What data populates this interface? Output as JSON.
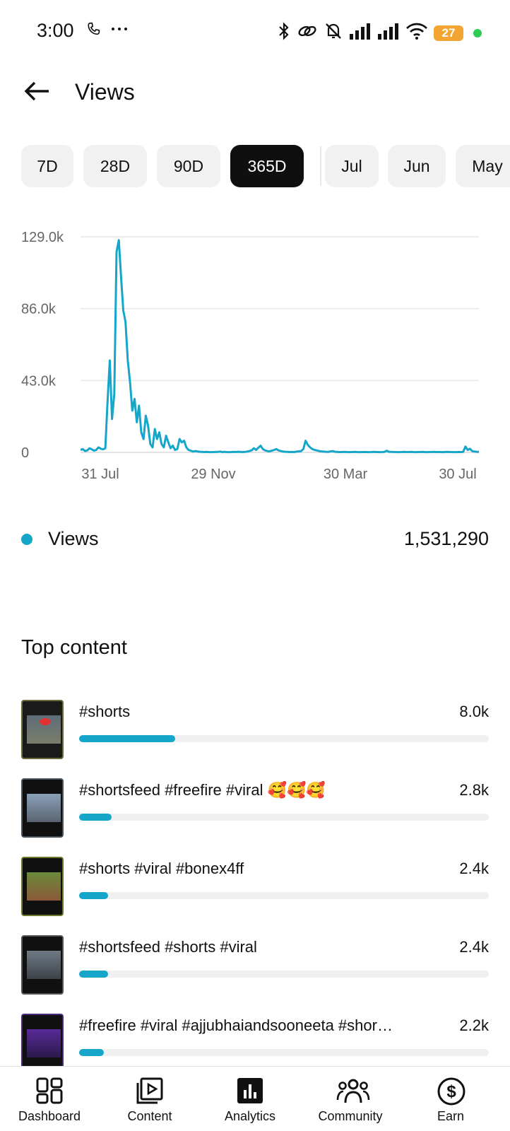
{
  "status_bar": {
    "time": "3:00",
    "battery": "27"
  },
  "header": {
    "title": "Views"
  },
  "period_chips": [
    {
      "label": "7D",
      "active": false
    },
    {
      "label": "28D",
      "active": false
    },
    {
      "label": "90D",
      "active": false
    },
    {
      "label": "365D",
      "active": true
    },
    {
      "label": "Jul",
      "active": false
    },
    {
      "label": "Jun",
      "active": false
    },
    {
      "label": "May",
      "active": false
    }
  ],
  "chart_data": {
    "type": "line",
    "y_ticks": [
      "129.0k",
      "86.0k",
      "43.0k",
      "0"
    ],
    "x_ticks": [
      "31 Jul",
      "29 Nov",
      "30 Mar",
      "30 Jul"
    ],
    "ylim": [
      0,
      129000
    ],
    "grid": true,
    "series": [
      {
        "name": "Views",
        "color": "#16a6c9",
        "values": [
          1500,
          2000,
          800,
          1200,
          2500,
          1800,
          1000,
          1500,
          3000,
          2200,
          1800,
          2500,
          30000,
          55000,
          20000,
          35000,
          120000,
          127000,
          105000,
          85000,
          78000,
          55000,
          42000,
          25000,
          32000,
          18000,
          28000,
          12000,
          8000,
          22000,
          16000,
          5000,
          3000,
          14000,
          8000,
          12000,
          5000,
          3000,
          10000,
          6000,
          2500,
          4000,
          1500,
          2000,
          8000,
          6000,
          7000,
          3000,
          1500,
          1000,
          500,
          800,
          600,
          400,
          300,
          200,
          300,
          200,
          150,
          200,
          250,
          300,
          500,
          200,
          300,
          200,
          150,
          200,
          300,
          250,
          400,
          300,
          200,
          300,
          500,
          800,
          1200,
          2500,
          1500,
          2800,
          4000,
          2000,
          1200,
          800,
          600,
          1000,
          1500,
          2000,
          1200,
          800,
          500,
          400,
          300,
          200,
          300,
          200,
          500,
          600,
          800,
          2000,
          7000,
          4500,
          3000,
          2000,
          1500,
          1200,
          800,
          600,
          500,
          400,
          300,
          600,
          800,
          400,
          300,
          200,
          200,
          300,
          250,
          150,
          200,
          250,
          300,
          200,
          150,
          200,
          250,
          200,
          150,
          200,
          300,
          250,
          200,
          150,
          200,
          300,
          1000,
          400,
          300,
          250,
          200,
          150,
          200,
          250,
          300,
          200,
          250,
          300,
          200,
          150,
          200,
          250,
          300,
          200,
          150,
          200,
          250,
          300,
          200,
          250,
          200,
          150,
          250,
          300,
          250,
          200,
          150,
          200,
          250,
          200,
          300,
          3500,
          1500,
          2200,
          800,
          500,
          400,
          300
        ]
      }
    ]
  },
  "legend": {
    "label": "Views",
    "total": "1,531,290"
  },
  "top_content": {
    "title": "Top content",
    "items": [
      {
        "title": "#shorts",
        "value": "8.0k",
        "share": 0.235
      },
      {
        "title": "#shortsfeed #freefire #viral 🥰🥰🥰",
        "value": "2.8k",
        "share": 0.08
      },
      {
        "title": "#shorts #viral #bonex4ff",
        "value": "2.4k",
        "share": 0.07
      },
      {
        "title": "#shortsfeed #shorts #viral",
        "value": "2.4k",
        "share": 0.07
      },
      {
        "title": "#freefire #viral #ajjubhaiandsooneeta #shor…",
        "value": "2.2k",
        "share": 0.06
      }
    ]
  },
  "bottom_nav": {
    "items": [
      {
        "label": "Dashboard",
        "icon": "dashboard-icon"
      },
      {
        "label": "Content",
        "icon": "content-icon"
      },
      {
        "label": "Analytics",
        "icon": "analytics-icon",
        "active": true
      },
      {
        "label": "Community",
        "icon": "community-icon"
      },
      {
        "label": "Earn",
        "icon": "earn-icon"
      }
    ]
  }
}
